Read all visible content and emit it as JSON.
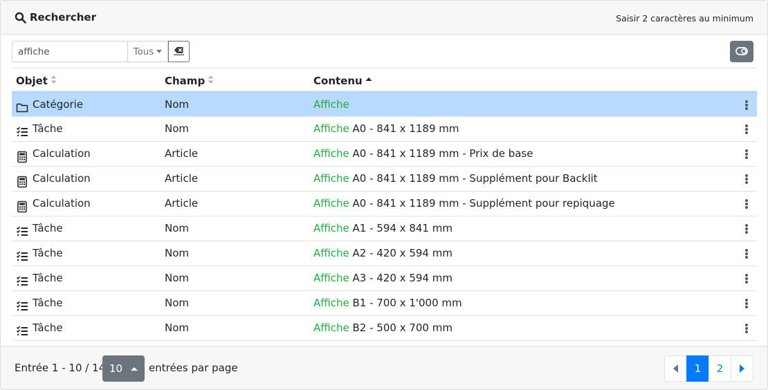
{
  "header": {
    "title": "Rechercher",
    "hint": "Saisir 2 caractères au minimum"
  },
  "search": {
    "value": "affiche",
    "type_label": "Tous"
  },
  "columns": {
    "object": "Objet",
    "field": "Champ",
    "content": "Contenu"
  },
  "rows": [
    {
      "icon": "folder-icon",
      "object": "Catégorie",
      "field": "Nom",
      "match": "Affiche",
      "rest": "",
      "selected": true
    },
    {
      "icon": "task-list-icon",
      "object": "Tâche",
      "field": "Nom",
      "match": "Affiche",
      "rest": " A0 - 841 x 1189 mm"
    },
    {
      "icon": "calculator-icon",
      "object": "Calculation",
      "field": "Article",
      "match": "Affiche",
      "rest": " A0 - 841 x 1189 mm - Prix de base"
    },
    {
      "icon": "calculator-icon",
      "object": "Calculation",
      "field": "Article",
      "match": "Affiche",
      "rest": " A0 - 841 x 1189 mm - Supplément pour Backlit"
    },
    {
      "icon": "calculator-icon",
      "object": "Calculation",
      "field": "Article",
      "match": "Affiche",
      "rest": " A0 - 841 x 1189 mm - Supplément pour repiquage"
    },
    {
      "icon": "task-list-icon",
      "object": "Tâche",
      "field": "Nom",
      "match": "Affiche",
      "rest": " A1 - 594 x 841 mm"
    },
    {
      "icon": "task-list-icon",
      "object": "Tâche",
      "field": "Nom",
      "match": "Affiche",
      "rest": " A2 - 420 x 594 mm"
    },
    {
      "icon": "task-list-icon",
      "object": "Tâche",
      "field": "Nom",
      "match": "Affiche",
      "rest": " A3 - 420 x 594 mm"
    },
    {
      "icon": "task-list-icon",
      "object": "Tâche",
      "field": "Nom",
      "match": "Affiche",
      "rest": " B1 - 700 x 1'000 mm"
    },
    {
      "icon": "task-list-icon",
      "object": "Tâche",
      "field": "Nom",
      "match": "Affiche",
      "rest": " B2 - 500 x 700 mm"
    }
  ],
  "footer": {
    "entries": "Entrée 1 - 10 / 14",
    "page_size": "10",
    "per_page": "entrées par page",
    "pages": [
      "1",
      "2"
    ],
    "active_page": "1"
  },
  "colors": {
    "highlight": "#28a745",
    "selected_row": "#b8daff",
    "primary": "#007bff",
    "secondary": "#6c757d"
  }
}
